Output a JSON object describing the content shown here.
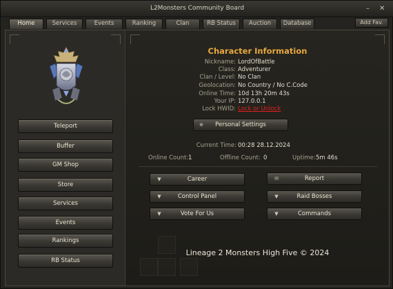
{
  "window": {
    "title": "L2Monsters Community Board",
    "minimize": "–",
    "close": "✕"
  },
  "tabs": [
    {
      "label": "Home",
      "active": true
    },
    {
      "label": "Services"
    },
    {
      "label": "Events"
    },
    {
      "label": "Ranking"
    },
    {
      "label": "Clan"
    },
    {
      "label": "RB Status"
    },
    {
      "label": "Auction"
    },
    {
      "label": "Database"
    }
  ],
  "add_fav": "Add Fav.",
  "sidebar": {
    "items": [
      "Teleport",
      "Buffer",
      "GM Shop",
      "Store",
      "Services",
      "Events",
      "Rankings",
      "RB Status"
    ]
  },
  "char_info": {
    "title": "Character Information",
    "rows": [
      {
        "label": "Nickname:",
        "value": "LordOfBattle"
      },
      {
        "label": "Class:",
        "value": "Adventurer"
      },
      {
        "label": "Clan / Level:",
        "value": "No Clan"
      },
      {
        "label": "Geolocation:",
        "value": "No Country / No C.Code"
      },
      {
        "label": "Online Time:",
        "value": "10d 13h 20m 43s"
      },
      {
        "label": "Your IP:",
        "value": "127.0.0.1"
      },
      {
        "label": "Lock HWID:",
        "value": "Lock or Unlock"
      }
    ]
  },
  "personal_settings": "Personal Settings",
  "current_time": {
    "label": "Current Time:",
    "value": "00:28 28.12.2024"
  },
  "stats": {
    "online": {
      "label": "Online Count:",
      "value": "1"
    },
    "offline": {
      "label": "Offline Count:",
      "value": "0"
    },
    "uptime": {
      "label": "Uptime:",
      "value": "5m 46s"
    }
  },
  "actions_left": [
    "Career",
    "Control Panel",
    "Vote For Us"
  ],
  "actions_right": [
    "Report",
    "Raid Bosses",
    "Commands"
  ],
  "footer": "Lineage 2 Monsters High Five © 2024",
  "colors": {
    "accent": "#e8a83e",
    "link": "#e02020"
  }
}
